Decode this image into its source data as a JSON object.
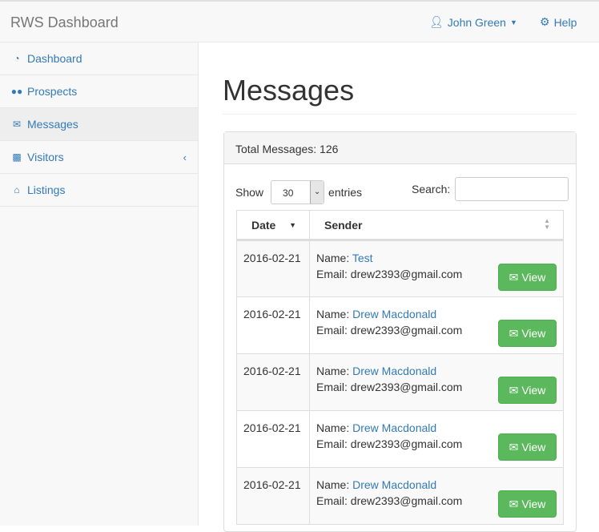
{
  "navbar": {
    "brand": "RWS Dashboard",
    "user": "John Green",
    "help": "Help"
  },
  "sidebar": {
    "items": [
      {
        "label": "Dashboard",
        "icon": "dashboard-icon"
      },
      {
        "label": "Prospects",
        "icon": "users-icon"
      },
      {
        "label": "Messages",
        "icon": "envelope-icon",
        "active": true
      },
      {
        "label": "Visitors",
        "icon": "bar-chart-icon"
      },
      {
        "label": "Listings",
        "icon": "home-icon"
      }
    ]
  },
  "main": {
    "title": "Messages",
    "total": "Total Messages: 126",
    "show_label": "Show",
    "entries_value": "30",
    "entries_label": "entries",
    "search_label": "Search:",
    "search_value": "",
    "columns": {
      "date": "Date",
      "sender": "Sender"
    },
    "name_label": "Name:",
    "email_label": "Email:",
    "view_label": "View",
    "rows": [
      {
        "date": "2016-02-21",
        "name": "Test",
        "email": "drew2393@gmail.com"
      },
      {
        "date": "2016-02-21",
        "name": "Drew Macdonald",
        "email": "drew2393@gmail.com"
      },
      {
        "date": "2016-02-21",
        "name": "Drew Macdonald",
        "email": "drew2393@gmail.com"
      },
      {
        "date": "2016-02-21",
        "name": "Drew Macdonald",
        "email": "drew2393@gmail.com"
      },
      {
        "date": "2016-02-21",
        "name": "Drew Macdonald",
        "email": "drew2393@gmail.com"
      }
    ]
  },
  "colors": {
    "link": "#337ab7",
    "success": "#5cb85c"
  }
}
